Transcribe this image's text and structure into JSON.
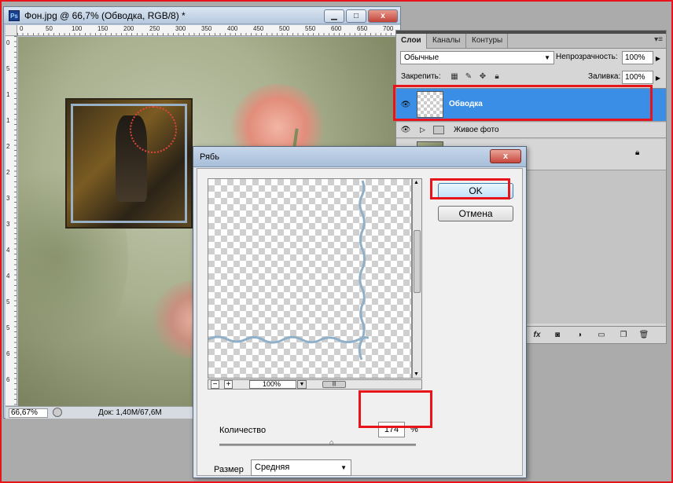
{
  "document": {
    "app_icon": "Ps",
    "title": "Фон.jpg @ 66,7% (Обводка, RGB/8) *",
    "ruler_top": [
      "0",
      "50",
      "100",
      "150",
      "200",
      "250",
      "300",
      "350",
      "400",
      "450",
      "500",
      "550",
      "600",
      "650",
      "700"
    ],
    "ruler_left": [
      "0",
      "5",
      "1",
      "1",
      "2",
      "2",
      "3",
      "3",
      "4",
      "4",
      "5",
      "5",
      "6",
      "6"
    ],
    "zoom": "66,67%",
    "info": "Док: 1,40M/67,6M"
  },
  "layers_panel": {
    "tabs": [
      "Слои",
      "Каналы",
      "Контуры"
    ],
    "menu_glyph": "▾≡",
    "blend_mode": "Обычные",
    "opacity_label": "Непрозрачность:",
    "opacity_value": "100%",
    "lock_label": "Закрепить:",
    "fill_label": "Заливка:",
    "fill_value": "100%",
    "layers": [
      {
        "name": "Обводка",
        "selected": true
      },
      {
        "name": "Живое фото",
        "selected": false
      },
      {
        "name": "",
        "selected": false
      }
    ],
    "bottom_icons": [
      "link-icon",
      "fx-icon",
      "mask-icon",
      "adjustment-icon",
      "group-icon",
      "new-layer-icon",
      "trash-icon"
    ],
    "fx_label": "fx"
  },
  "dialog": {
    "title": "Рябь",
    "close_label": "x",
    "ok_label": "OK",
    "cancel_label": "Отмена",
    "zoom_minus": "−",
    "zoom_plus": "+",
    "preview_zoom": "100%",
    "amount_label": "Количество",
    "amount_value": "174",
    "amount_unit": "%",
    "amount_slider_value": 174,
    "size_label": "Размер",
    "size_value": "Средняя"
  },
  "colors": {
    "highlight": "#e8141c",
    "selected_layer": "#3a8ee6"
  }
}
